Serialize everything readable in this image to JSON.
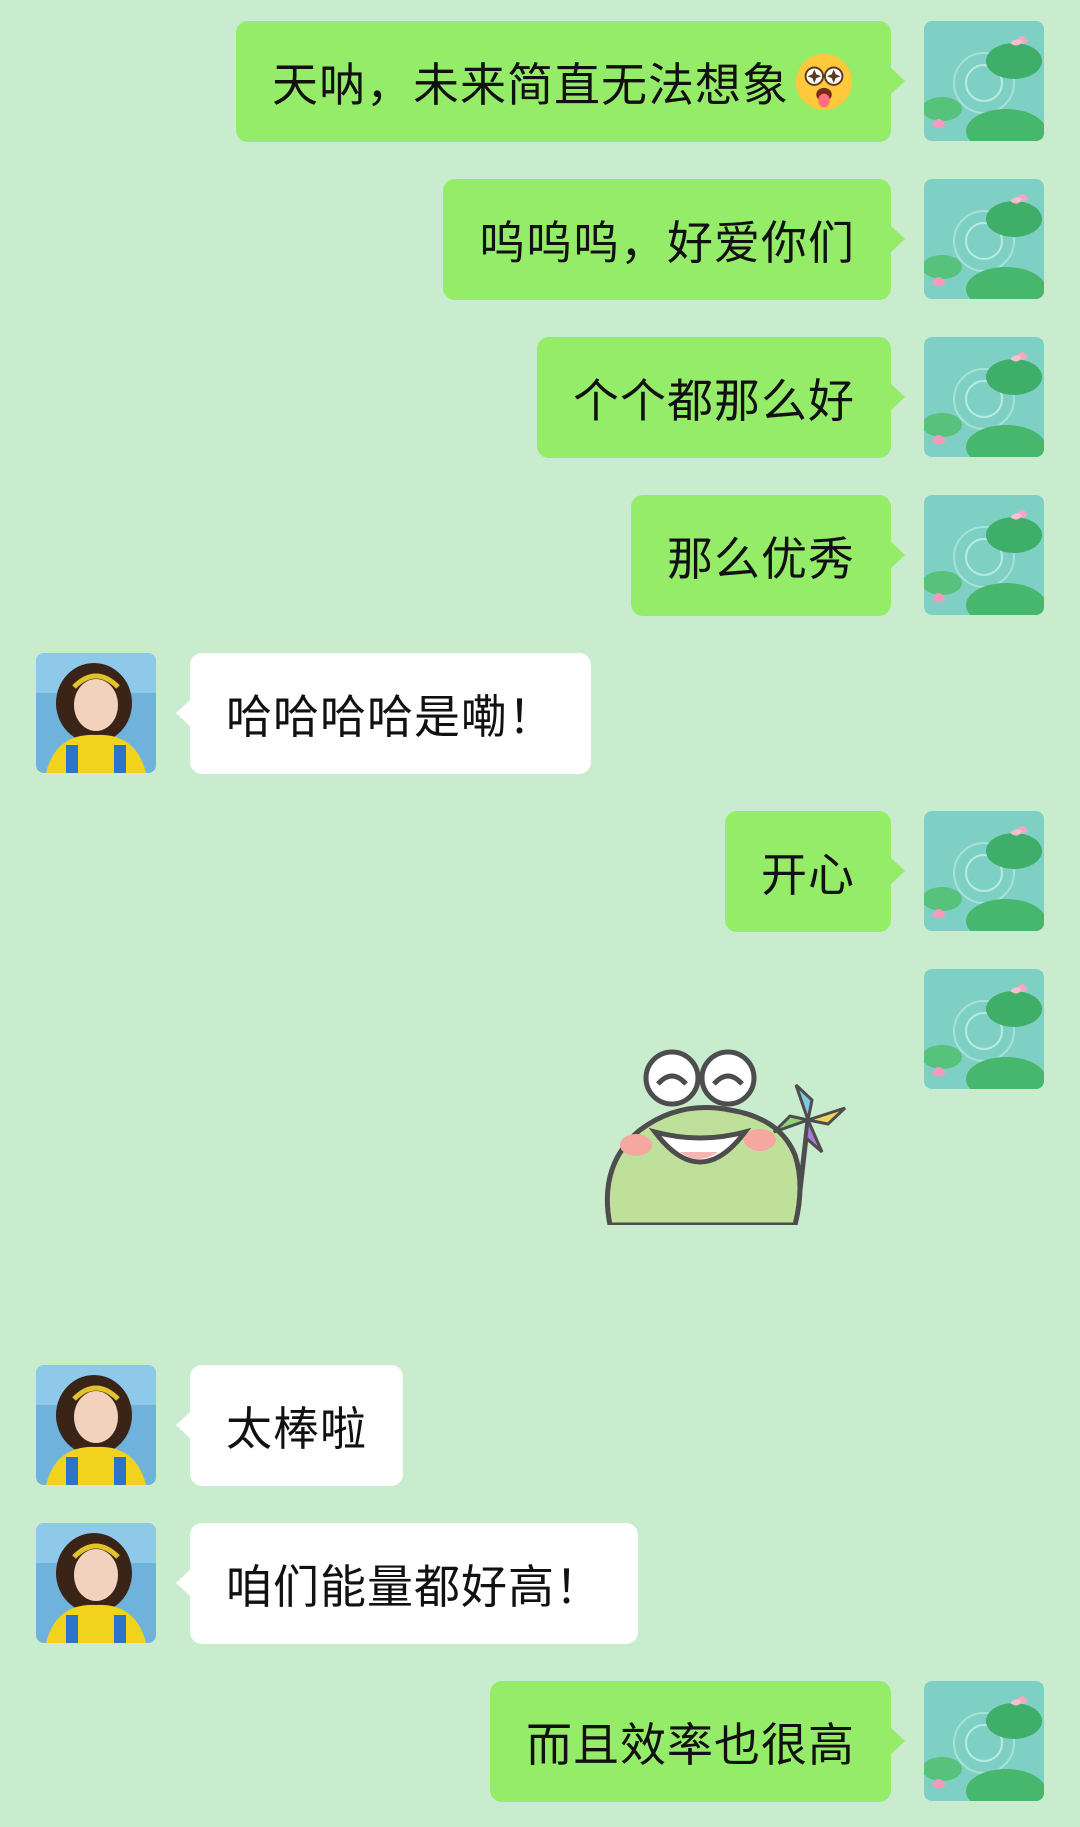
{
  "messages": [
    {
      "side": "self",
      "text": "天呐，未来简直无法想象",
      "emoji": "star-eyes-tongue-emoji"
    },
    {
      "side": "self",
      "text": "呜呜呜，好爱你们"
    },
    {
      "side": "self",
      "text": "个个都那么好"
    },
    {
      "side": "self",
      "text": "那么优秀"
    },
    {
      "side": "other",
      "text": "哈哈哈哈是嘞！"
    },
    {
      "side": "self",
      "text": "开心"
    },
    {
      "side": "self",
      "sticker": "frog-pinwheel-sticker"
    },
    {
      "side": "other",
      "text": "太棒啦"
    },
    {
      "side": "other",
      "text": "咱们能量都好高！"
    },
    {
      "side": "self",
      "text": "而且效率也很高"
    }
  ],
  "avatars": {
    "self": "lotus-pond-avatar",
    "other": "girl-portrait-avatar"
  },
  "colors": {
    "background": "#c9ebce",
    "self_bubble": "#95ec69",
    "other_bubble": "#ffffff"
  }
}
